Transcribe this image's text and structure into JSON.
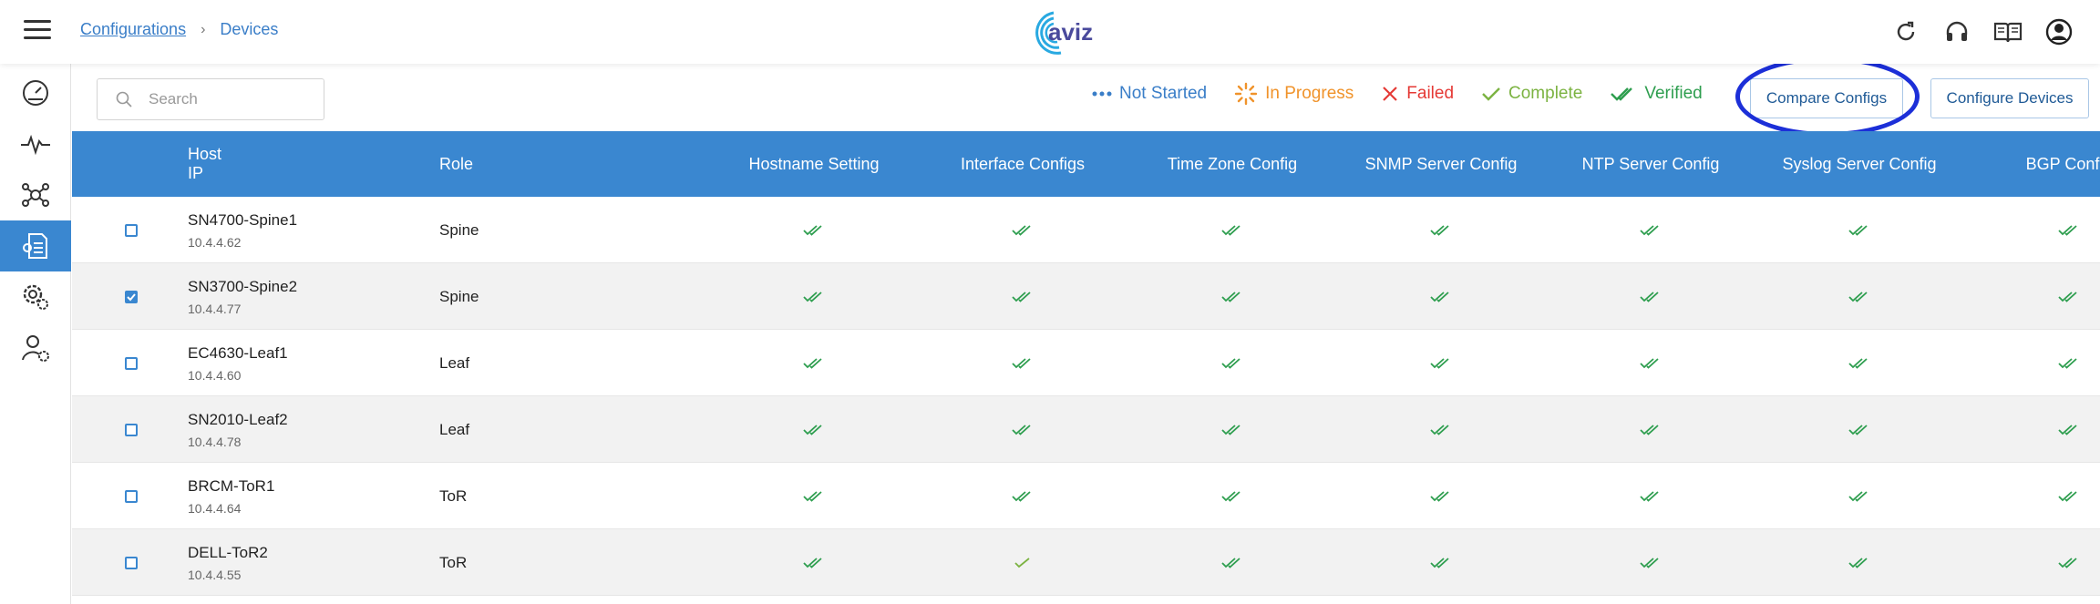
{
  "header": {
    "breadcrumb": {
      "parent": "Configurations",
      "separator": "›",
      "current": "Devices"
    },
    "logo_text": "aviz",
    "icons": [
      "refresh-icon",
      "headset-icon",
      "book-icon",
      "user-icon"
    ]
  },
  "sidebar": {
    "items": [
      {
        "icon": "dashboard-gauge-icon",
        "active": false
      },
      {
        "icon": "pulse-icon",
        "active": false
      },
      {
        "icon": "network-topology-icon",
        "active": false
      },
      {
        "icon": "config-document-icon",
        "active": true
      },
      {
        "icon": "settings-gears-icon",
        "active": false
      },
      {
        "icon": "user-settings-icon",
        "active": false
      }
    ]
  },
  "toolbar": {
    "search_placeholder": "Search",
    "legend": [
      {
        "label": "Not Started",
        "color": "#3a7ec8",
        "icon": "dots-icon"
      },
      {
        "label": "In Progress",
        "color": "#f0932b",
        "icon": "spinner-icon"
      },
      {
        "label": "Failed",
        "color": "#e53935",
        "icon": "cross-icon"
      },
      {
        "label": "Complete",
        "color": "#7cb342",
        "icon": "check-icon"
      },
      {
        "label": "Verified",
        "color": "#2e9e4f",
        "icon": "double-check-icon"
      }
    ],
    "compare_label": "Compare Configs",
    "configure_label": "Configure Devices"
  },
  "table": {
    "headers": {
      "host": "Host",
      "ip": "IP",
      "role": "Role",
      "columns": [
        "Hostname Setting",
        "Interface Configs",
        "Time Zone Config",
        "SNMP Server Config",
        "NTP Server Config",
        "Syslog Server Config",
        "BGP Config"
      ]
    },
    "rows": [
      {
        "host": "SN4700-Spine1",
        "ip": "10.4.4.62",
        "role": "Spine",
        "checked": false,
        "status": [
          "verified",
          "verified",
          "verified",
          "verified",
          "verified",
          "verified",
          "verified"
        ]
      },
      {
        "host": "SN3700-Spine2",
        "ip": "10.4.4.77",
        "role": "Spine",
        "checked": true,
        "status": [
          "verified",
          "verified",
          "verified",
          "verified",
          "verified",
          "verified",
          "verified"
        ]
      },
      {
        "host": "EC4630-Leaf1",
        "ip": "10.4.4.60",
        "role": "Leaf",
        "checked": false,
        "status": [
          "verified",
          "verified",
          "verified",
          "verified",
          "verified",
          "verified",
          "verified"
        ]
      },
      {
        "host": "SN2010-Leaf2",
        "ip": "10.4.4.78",
        "role": "Leaf",
        "checked": false,
        "status": [
          "verified",
          "verified",
          "verified",
          "verified",
          "verified",
          "verified",
          "verified"
        ]
      },
      {
        "host": "BRCM-ToR1",
        "ip": "10.4.4.64",
        "role": "ToR",
        "checked": false,
        "status": [
          "verified",
          "verified",
          "verified",
          "verified",
          "verified",
          "verified",
          "verified"
        ]
      },
      {
        "host": "DELL-ToR2",
        "ip": "10.4.4.55",
        "role": "ToR",
        "checked": false,
        "status": [
          "verified",
          "complete",
          "verified",
          "verified",
          "verified",
          "verified",
          "verified"
        ]
      }
    ]
  },
  "colors": {
    "accent": "#3a87d0",
    "verified": "#2e9e4f",
    "complete": "#7cb342",
    "highlight_ring": "#1c2fd8"
  }
}
